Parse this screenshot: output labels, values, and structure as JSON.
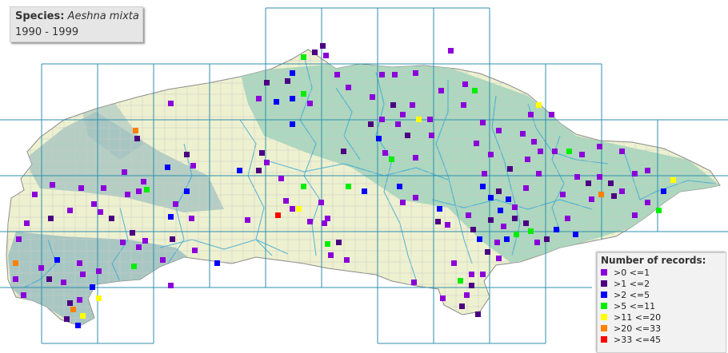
{
  "title": {
    "species_label": "Species:",
    "species_name": "Aeshna mixta",
    "period": "1990 - 1999"
  },
  "legend": {
    "title": "Number of records:",
    "items": [
      {
        "label": ">0 <=1",
        "color": "#8b00d9"
      },
      {
        "label": ">1 <=2",
        "color": "#4b0082"
      },
      {
        "label": ">2 <=5",
        "color": "#0000ff"
      },
      {
        "label": ">5 <=11",
        "color": "#00ee00"
      },
      {
        "label": ">11 <=20",
        "color": "#ffff00"
      },
      {
        "label": ">20 <=33",
        "color": "#ff8000"
      },
      {
        "label": ">33 <=45",
        "color": "#ff0000"
      }
    ]
  },
  "colors": {
    "land": "#eef1cf",
    "chalk": "#a9d5bd",
    "downs": "#9cbfbf",
    "river": "#35a7d6",
    "grid_major": "#2f8fb0",
    "grid_minor": "#c9c9c9",
    "background": "#ffffff"
  }
}
